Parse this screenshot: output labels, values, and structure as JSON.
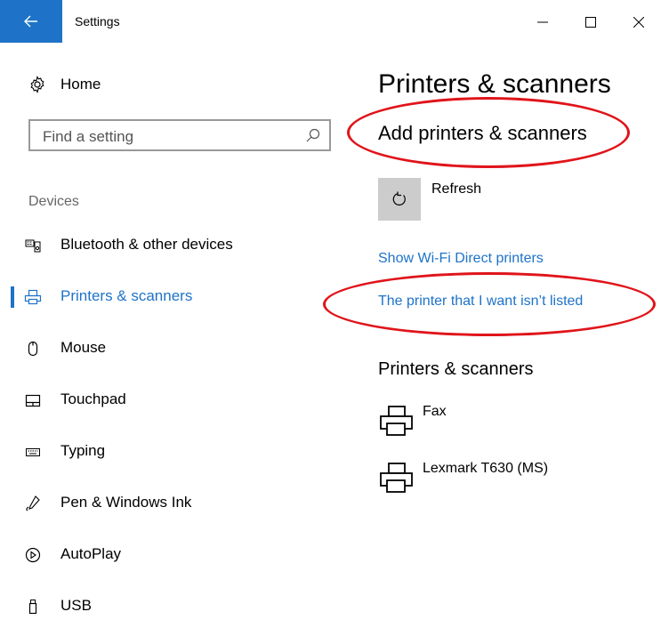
{
  "window": {
    "title": "Settings",
    "back_icon": "back-arrow-icon",
    "minimize_icon": "minimize-icon",
    "maximize_icon": "maximize-icon",
    "close_icon": "close-icon",
    "accent_color": "#1e73c8"
  },
  "sidebar": {
    "home_label": "Home",
    "search_placeholder": "Find a setting",
    "section_label": "Devices",
    "items": [
      {
        "label": "Bluetooth & other devices",
        "icon": "bluetooth-devices-icon",
        "selected": false
      },
      {
        "label": "Printers & scanners",
        "icon": "printer-icon",
        "selected": true
      },
      {
        "label": "Mouse",
        "icon": "mouse-icon",
        "selected": false
      },
      {
        "label": "Touchpad",
        "icon": "touchpad-icon",
        "selected": false
      },
      {
        "label": "Typing",
        "icon": "keyboard-icon",
        "selected": false
      },
      {
        "label": "Pen & Windows Ink",
        "icon": "pen-icon",
        "selected": false
      },
      {
        "label": "AutoPlay",
        "icon": "autoplay-icon",
        "selected": false
      },
      {
        "label": "USB",
        "icon": "usb-icon",
        "selected": false
      }
    ]
  },
  "main": {
    "title": "Printers & scanners",
    "add_heading": "Add printers & scanners",
    "refresh_label": "Refresh",
    "link_wifi_direct": "Show Wi-Fi Direct printers",
    "link_not_listed": "The printer that I want isn’t listed",
    "devices_heading": "Printers & scanners",
    "devices": [
      {
        "name": "Fax",
        "icon": "printer-icon"
      },
      {
        "name": "Lexmark T630 (MS)",
        "icon": "printer-icon"
      }
    ]
  },
  "annotation_color": "#e0141a"
}
